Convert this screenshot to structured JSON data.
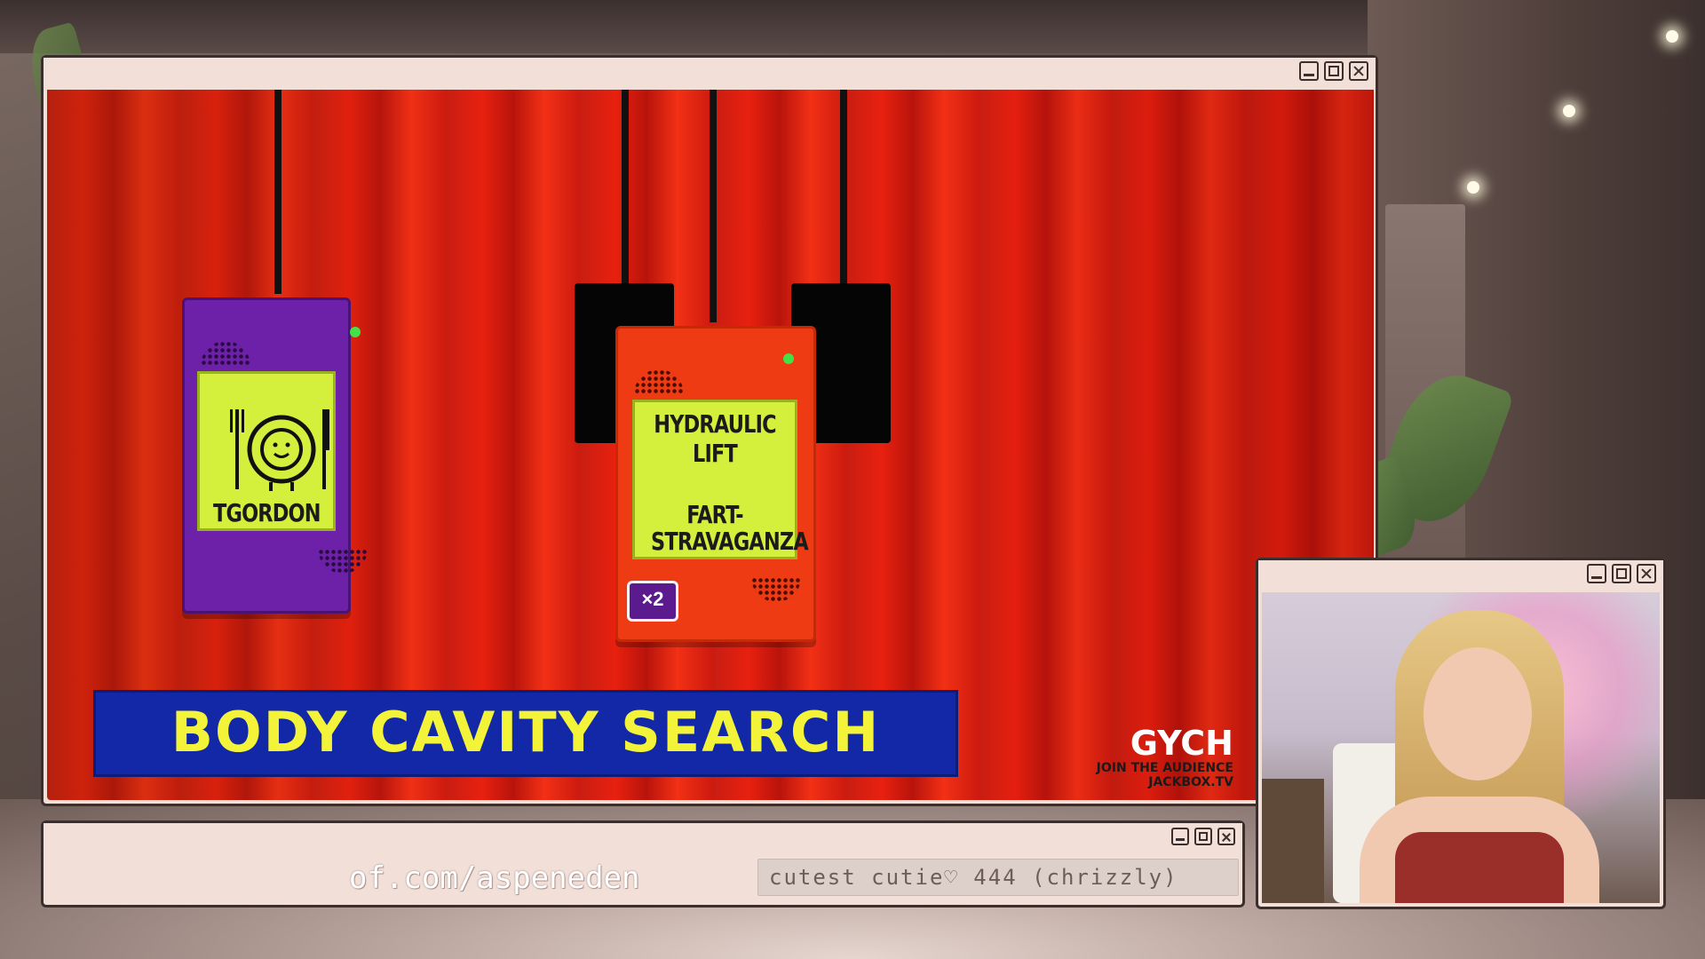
{
  "game": {
    "device_left_name": "TGORDON",
    "device_right_line1": "HYDRAULIC LIFT",
    "device_right_line2": "FART-",
    "device_right_line3": "STRAVAGANZA",
    "badge_text": "×2",
    "title": "BODY CAVITY SEARCH",
    "room_code": "GYCH",
    "join_line1": "JOIN THE AUDIENCE",
    "join_line2": "JACKBOX.TV"
  },
  "ticker": {
    "link": "of.com/aspeneden",
    "message": "cutest cutie♡ 444 (chrizzly)"
  },
  "colors": {
    "curtain": "#e8200f",
    "device_purple": "#6d21a9",
    "device_red": "#ee3b14",
    "screen_lime": "#d4f03c",
    "banner_blue": "#1228a6",
    "banner_text": "#f3f33a",
    "window_frame": "#f1dfd8"
  },
  "icons": {
    "left_screen": "plate-with-fork-knife-face-icon",
    "window_controls": [
      "minimize-icon",
      "maximize-icon",
      "close-icon"
    ]
  }
}
